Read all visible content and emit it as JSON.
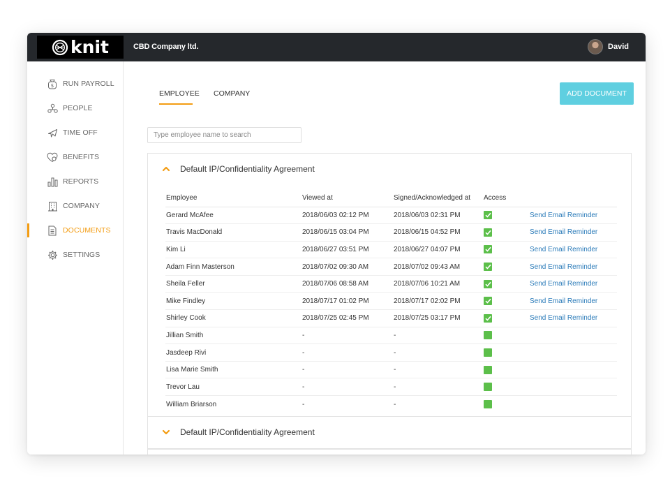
{
  "app": {
    "logo": "knit",
    "company": "CBD Company ltd.",
    "user": "David"
  },
  "sidebar": {
    "items": [
      {
        "label": "RUN PAYROLL",
        "icon": "money-bag-icon"
      },
      {
        "label": "PEOPLE",
        "icon": "people-icon"
      },
      {
        "label": "TIME OFF",
        "icon": "airplane-icon"
      },
      {
        "label": "BENEFITS",
        "icon": "heart-icon"
      },
      {
        "label": "REPORTS",
        "icon": "bar-chart-icon"
      },
      {
        "label": "COMPANY",
        "icon": "building-icon"
      },
      {
        "label": "DOCUMENTS",
        "icon": "document-icon"
      },
      {
        "label": "SETTINGS",
        "icon": "gear-icon"
      }
    ],
    "active": "DOCUMENTS"
  },
  "tabs": {
    "employee": "EMPLOYEE",
    "company": "COMPANY",
    "active": "EMPLOYEE"
  },
  "add_document": "ADD DOCUMENT",
  "search": {
    "placeholder": "Type employee name to search",
    "value": ""
  },
  "documents": [
    {
      "title": "Default IP/Confidentiality Agreement",
      "expanded": true,
      "columns": [
        "Employee",
        "Viewed at",
        "Signed/Acknowledged at",
        "Access"
      ],
      "rows": [
        {
          "employee": "Gerard McAfee",
          "viewed": "2018/06/03 02:12 PM",
          "signed": "2018/06/03 02:31 PM",
          "access": true,
          "action": "Send Email Reminder"
        },
        {
          "employee": "Travis MacDonald",
          "viewed": "2018/06/15 03:04 PM",
          "signed": "2018/06/15 04:52 PM",
          "access": true,
          "action": "Send Email Reminder"
        },
        {
          "employee": "Kim Li",
          "viewed": "2018/06/27 03:51 PM",
          "signed": "2018/06/27 04:07 PM",
          "access": true,
          "action": "Send Email Reminder"
        },
        {
          "employee": "Adam Finn Masterson",
          "viewed": "2018/07/02 09:30 AM",
          "signed": "2018/07/02 09:43 AM",
          "access": true,
          "action": "Send Email Reminder"
        },
        {
          "employee": "Sheila Feller",
          "viewed": "2018/07/06 08:58 AM",
          "signed": "2018/07/06 10:21 AM",
          "access": true,
          "action": "Send Email Reminder"
        },
        {
          "employee": "Mike Findley",
          "viewed": "2018/07/17 01:02 PM",
          "signed": "2018/07/17 02:02 PM",
          "access": true,
          "action": "Send Email Reminder"
        },
        {
          "employee": "Shirley Cook",
          "viewed": "2018/07/25 02:45 PM",
          "signed": "2018/07/25 03:17 PM",
          "access": true,
          "action": "Send Email Reminder"
        },
        {
          "employee": "Jillian Smith",
          "viewed": "-",
          "signed": "-",
          "access": false,
          "action": ""
        },
        {
          "employee": "Jasdeep Rivi",
          "viewed": "-",
          "signed": "-",
          "access": false,
          "action": ""
        },
        {
          "employee": "Lisa Marie Smith",
          "viewed": "-",
          "signed": "-",
          "access": false,
          "action": ""
        },
        {
          "employee": "Trevor Lau",
          "viewed": "-",
          "signed": "-",
          "access": false,
          "action": ""
        },
        {
          "employee": "William Briarson",
          "viewed": "-",
          "signed": "-",
          "access": false,
          "action": ""
        }
      ]
    },
    {
      "title": "Default IP/Confidentiality Agreement",
      "expanded": false
    }
  ],
  "colors": {
    "accent": "#f39c12",
    "button": "#5fcfe0",
    "check": "#5cbf4a",
    "link": "#2b7bb9",
    "topbar": "#25282c"
  }
}
